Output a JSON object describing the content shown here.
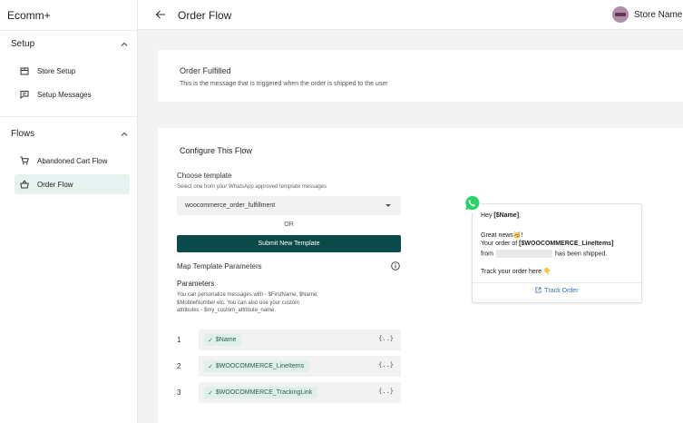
{
  "app": {
    "brand": "Ecomm+"
  },
  "sidebar": {
    "sections": [
      {
        "title": "Setup",
        "items": [
          {
            "label": "Store Setup"
          },
          {
            "label": "Setup Messages"
          }
        ]
      },
      {
        "title": "Flows",
        "items": [
          {
            "label": "Abandoned Cart Flow"
          },
          {
            "label": "Order Flow"
          }
        ]
      }
    ]
  },
  "header": {
    "title": "Order Flow",
    "store_label": "Store Name:"
  },
  "event": {
    "title": "Order Fulfilled",
    "description": "This is the message that is triggered when the order is shipped to the user"
  },
  "configure": {
    "title": "Configure This Flow",
    "choose_label": "Choose template",
    "choose_hint": "Select one from your WhatsApp approved template messages",
    "selected_template": "woocommerce_order_fulfillment",
    "or": "OR",
    "submit_label": "Submit New Template",
    "map_title": "Map Template Parameters",
    "params_title": "Parameters",
    "params_desc": "You can personalize messages with - $FirstName, $Name, $MobileNumber etc. You can also use your custom attributes - $my_custom_attribute_name.",
    "params": [
      {
        "num": "1",
        "value": "$Name",
        "brace": "{..}"
      },
      {
        "num": "2",
        "value": "$WOOCOMMERCE_LineItems",
        "brace": "{..}"
      },
      {
        "num": "3",
        "value": "$WOOCOMMERCE_TrackingLink",
        "brace": "{..}"
      }
    ]
  },
  "preview": {
    "greeting_prefix": "Hey ",
    "greeting_var": "[$Name]",
    "greeting_suffix": ",",
    "news": "Great news🥳!",
    "order_prefix": "Your order of ",
    "order_var": "[$WOOCOMMERCE_LineItems]",
    "from": "from",
    "shipped": "has been shipped.",
    "track_text": "Track your order here 👇",
    "track_button": "Track Order"
  },
  "colors": {
    "accent": "#0b4a4a",
    "active_bg": "#e6f2ef",
    "whatsapp": "#25d366",
    "link": "#2f6fb0"
  }
}
